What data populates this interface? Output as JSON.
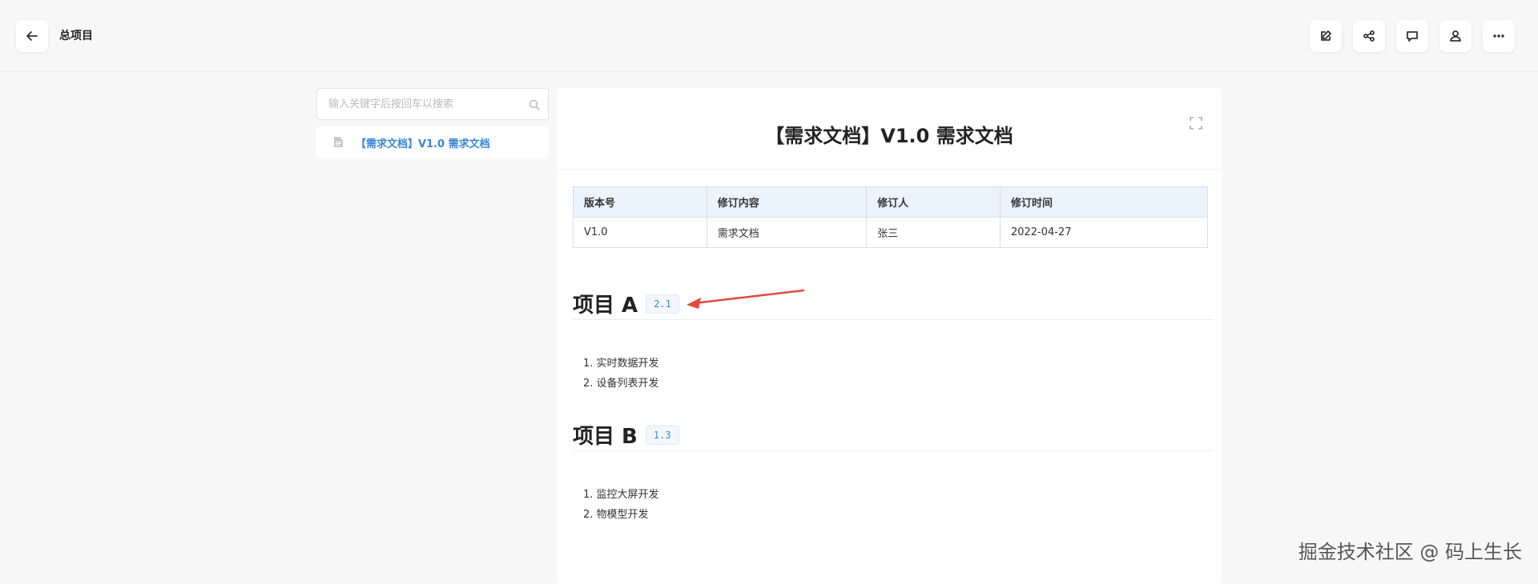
{
  "header": {
    "title": "总项目",
    "back_icon": "arrow-left-icon",
    "actions": [
      "edit-icon",
      "share-icon",
      "comment-icon",
      "user-icon",
      "more-icon"
    ]
  },
  "sidebar": {
    "search_placeholder": "输入关键字后按回车以搜索",
    "search_value": "",
    "items": [
      {
        "label": "【需求文档】V1.0 需求文档",
        "icon": "document-icon"
      }
    ]
  },
  "document": {
    "title": "【需求文档】V1.0 需求文档",
    "revision_table": {
      "headers": [
        "版本号",
        "修订内容",
        "修订人",
        "修订时间"
      ],
      "rows": [
        [
          "V1.0",
          "需求文档",
          "张三",
          "2022-04-27"
        ]
      ]
    },
    "sections": [
      {
        "heading": "项目 A",
        "tag": "2.1",
        "items": [
          "实时数据开发",
          "设备列表开发"
        ]
      },
      {
        "heading": "项目 B",
        "tag": "1.3",
        "items": [
          "监控大屏开发",
          "物模型开发"
        ]
      }
    ]
  },
  "colors": {
    "accent": "#3a86d6",
    "table_header_bg": "#ebf4fd",
    "annotation_arrow": "#e5483f"
  },
  "watermark": "掘金技术社区 @ 码上生长"
}
